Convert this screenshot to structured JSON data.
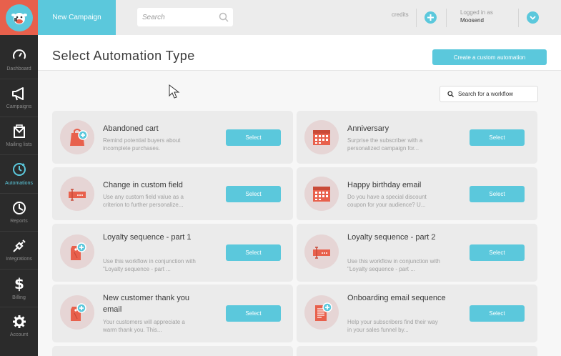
{
  "sidebar": {
    "items": [
      {
        "label": "Dashboard",
        "icon": "gauge-icon"
      },
      {
        "label": "Campaigns",
        "icon": "megaphone-icon"
      },
      {
        "label": "Mailing lists",
        "icon": "envelope-icon"
      },
      {
        "label": "Automations",
        "icon": "clock-icon",
        "active": true
      },
      {
        "label": "Reports",
        "icon": "pie-chart-icon"
      },
      {
        "label": "Integrations",
        "icon": "plug-icon"
      },
      {
        "label": "Billing",
        "icon": "dollar-icon"
      },
      {
        "label": "Account",
        "icon": "gear-icon"
      }
    ]
  },
  "topbar": {
    "new_campaign": "New Campaign",
    "search_placeholder": "Search",
    "credits": "credits",
    "logged_in_label": "Logged in as",
    "username": "Moosend"
  },
  "header": {
    "title": "Select Automation Type",
    "create_button": "Create a custom automation"
  },
  "workflow_search": {
    "placeholder": "Search for a workflow"
  },
  "cards": [
    {
      "title": "Abandoned cart",
      "desc": "Remind potential buyers about incomplete purchases.",
      "select": "Select",
      "icon": "shopping-bag-icon"
    },
    {
      "title": "Anniversary",
      "desc": "Surprise the subscriber with a personalized campaign for...",
      "select": "Select",
      "icon": "calendar-icon"
    },
    {
      "title": "Change in custom field",
      "desc": "Use any custom field value as a criterion to further personalize...",
      "select": "Select",
      "icon": "text-field-icon"
    },
    {
      "title": "Happy birthday email",
      "desc": "Do you have a special discount coupon for your audience? U...",
      "select": "Select",
      "icon": "calendar-icon"
    },
    {
      "title": "Loyalty sequence - part 1",
      "desc": "Use this workflow in conjunction with \"Loyalty sequence - part ...",
      "select": "Select",
      "icon": "tag-icon"
    },
    {
      "title": "Loyalty sequence - part 2",
      "desc": "Use this workflow in conjunction with \"Loyalty sequence - part ...",
      "select": "Select",
      "icon": "text-field-icon"
    },
    {
      "title": "New customer thank you email",
      "desc": "Your customers will appreciate a warm thank you. This...",
      "select": "Select",
      "icon": "tag-icon"
    },
    {
      "title": "Onboarding email sequence",
      "desc": "Help your subscribers find their way in your sales funnel by...",
      "select": "Select",
      "icon": "document-icon"
    }
  ],
  "colors": {
    "accent": "#5bc8dc",
    "brand": "#e8604c",
    "sidebar": "#2b2b2b"
  }
}
